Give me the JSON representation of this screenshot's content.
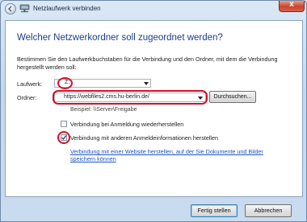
{
  "window": {
    "title": "Netzlaufwerk verbinden",
    "close_glyph": "x"
  },
  "dialog": {
    "heading": "Welcher Netzwerkordner soll zugeordnet werden?",
    "instructions": "Bestimmen Sie den Laufwerkbuchstaben für die Verbindung und den Ordner, mit dem die Verbindung hergestellt werden soll:",
    "drive": {
      "label": "Laufwerk:",
      "value": "Z:"
    },
    "folder": {
      "label": "Ordner:",
      "value": "https://webfiles2.cms.hu-berlin.de/"
    },
    "browse_label": "Durchsuchen...",
    "example": "Beispiel: \\\\Server\\Freigabe",
    "reconnect": {
      "label": "Verbindung bei Anmeldung wiederherstellen",
      "checked": false
    },
    "other_credentials": {
      "label": "Verbindung mit anderen Anmeldeinformationen herstellen",
      "checked": true
    },
    "link": "Verbindung mit einer Website herstellen, auf der Sie Dokumente und Bilder speichern können"
  },
  "footer": {
    "finish_label": "Fertig stellen",
    "cancel_label": "Abbrechen"
  },
  "colors": {
    "highlight": "#d2102a",
    "heading": "#1e3c8c",
    "link": "#1a55c4"
  }
}
